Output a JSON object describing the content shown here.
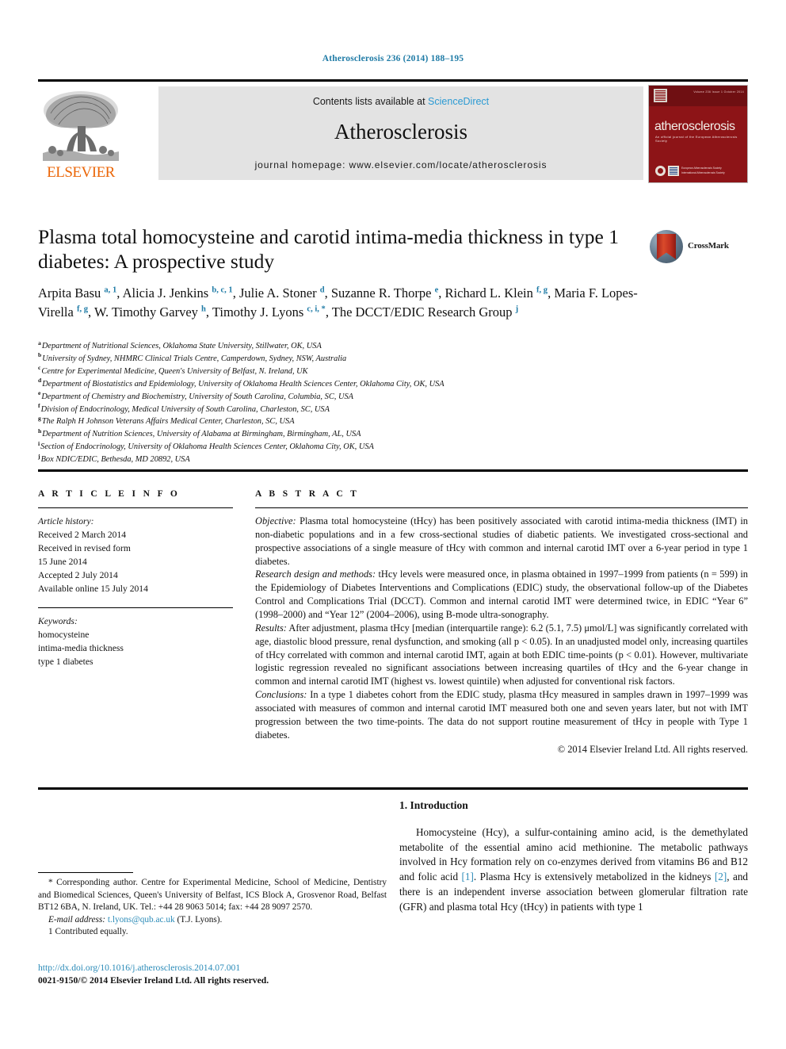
{
  "running_head": "Atherosclerosis 236 (2014) 188–195",
  "masthead": {
    "publisher_name": "ELSEVIER",
    "contents_prefix": "Contents lists available at ",
    "contents_link": "ScienceDirect",
    "journal_title": "Atherosclerosis",
    "homepage_line": "journal homepage: www.elsevier.com/locate/atherosclerosis",
    "cover": {
      "journal_name": "atherosclerosis",
      "subtitle": "An official journal of the European Atherosclerosis Society",
      "topright": "Volume 236  Issue 1  October 2014",
      "badge_text": "European Atherosclerosis Society  International Atherosclerosis Society"
    }
  },
  "article": {
    "title": "Plasma total homocysteine and carotid intima-media thickness in type 1 diabetes: A prospective study",
    "crossmark_label": "CrossMark",
    "authors": [
      {
        "name": "Arpita Basu",
        "sup": "a, 1",
        "sep": ", "
      },
      {
        "name": "Alicia J. Jenkins",
        "sup": "b, c, 1",
        "sep": ", "
      },
      {
        "name": "Julie A. Stoner",
        "sup": "d",
        "sep": ", "
      },
      {
        "name": "Suzanne R. Thorpe",
        "sup": "e",
        "sep": ", "
      },
      {
        "name": "Richard L. Klein",
        "sup": "f, g",
        "sep": ", "
      },
      {
        "name": "Maria F. Lopes-Virella",
        "sup": "f, g",
        "sep": ", "
      },
      {
        "name": "W. Timothy Garvey",
        "sup": "h",
        "sep": ", "
      },
      {
        "name": "Timothy J. Lyons",
        "sup": "c, i, *",
        "sep": ", "
      },
      {
        "name": "The DCCT/EDIC Research Group",
        "sup": "j",
        "sep": ""
      }
    ],
    "affiliations": [
      {
        "mark": "a",
        "text": "Department of Nutritional Sciences, Oklahoma State University, Stillwater, OK, USA"
      },
      {
        "mark": "b",
        "text": "University of Sydney, NHMRC Clinical Trials Centre, Camperdown, Sydney, NSW, Australia"
      },
      {
        "mark": "c",
        "text": "Centre for Experimental Medicine, Queen's University of Belfast, N. Ireland, UK"
      },
      {
        "mark": "d",
        "text": "Department of Biostatistics and Epidemiology, University of Oklahoma Health Sciences Center, Oklahoma City, OK, USA"
      },
      {
        "mark": "e",
        "text": "Department of Chemistry and Biochemistry, University of South Carolina, Columbia, SC, USA"
      },
      {
        "mark": "f",
        "text": "Division of Endocrinology, Medical University of South Carolina, Charleston, SC, USA"
      },
      {
        "mark": "g",
        "text": "The Ralph H Johnson Veterans Affairs Medical Center, Charleston, SC, USA"
      },
      {
        "mark": "h",
        "text": "Department of Nutrition Sciences, University of Alabama at Birmingham, Birmingham, AL, USA"
      },
      {
        "mark": "i",
        "text": "Section of Endocrinology, University of Oklahoma Health Sciences Center, Oklahoma City, OK, USA"
      },
      {
        "mark": "j",
        "text": "Box NDIC/EDIC, Bethesda, MD 20892, USA"
      }
    ]
  },
  "article_info": {
    "heading": "A R T I C L E   I N F O",
    "history_label": "Article history:",
    "history_lines": [
      "Received 2 March 2014",
      "Received in revised form",
      "15 June 2014",
      "Accepted 2 July 2014",
      "Available online 15 July 2014"
    ],
    "keywords_label": "Keywords:",
    "keywords": [
      "homocysteine",
      "intima-media thickness",
      "type 1 diabetes"
    ]
  },
  "abstract": {
    "heading": "A B S T R A C T",
    "objective_label": "Objective:",
    "objective_text": " Plasma total homocysteine (tHcy) has been positively associated with carotid intima-media thickness (IMT) in non-diabetic populations and in a few cross-sectional studies of diabetic patients. We investigated cross-sectional and prospective associations of a single measure of tHcy with common and internal carotid IMT over a 6-year period in type 1 diabetes.",
    "methods_label": "Research design and methods:",
    "methods_text": " tHcy levels were measured once, in plasma obtained in 1997–1999 from patients (n = 599) in the Epidemiology of Diabetes Interventions and Complications (EDIC) study, the observational follow-up of the Diabetes Control and Complications Trial (DCCT). Common and internal carotid IMT were determined twice, in EDIC “Year 6” (1998–2000) and “Year 12” (2004–2006), using B-mode ultra-sonography.",
    "results_label": "Results:",
    "results_text": " After adjustment, plasma tHcy [median (interquartile range): 6.2 (5.1, 7.5) μmol/L] was significantly correlated with age, diastolic blood pressure, renal dysfunction, and smoking (all p < 0.05). In an unadjusted model only, increasing quartiles of tHcy correlated with common and internal carotid IMT, again at both EDIC time-points (p < 0.01). However, multivariate logistic regression revealed no significant associations between increasing quartiles of tHcy and the 6-year change in common and internal carotid IMT (highest vs. lowest quintile) when adjusted for conventional risk factors.",
    "conclusions_label": "Conclusions:",
    "conclusions_text": " In a type 1 diabetes cohort from the EDIC study, plasma tHcy measured in samples drawn in 1997–1999 was associated with measures of common and internal carotid IMT measured both one and seven years later, but not with IMT progression between the two time-points. The data do not support routine measurement of tHcy in people with Type 1 diabetes.",
    "copyright": "© 2014 Elsevier Ireland Ltd. All rights reserved."
  },
  "introduction": {
    "heading": "1. Introduction",
    "paragraph_1a": "Homocysteine (Hcy), a sulfur-containing amino acid, is the demethylated metabolite of the essential amino acid methionine. The metabolic pathways involved in Hcy formation rely on co-enzymes derived from vitamins B6 and B12 and folic acid ",
    "cite_1": "[1]",
    "paragraph_1b": ". Plasma Hcy is extensively metabolized in the kidneys ",
    "cite_2": "[2]",
    "paragraph_1c": ", and there is an independent inverse association between glomerular filtration rate (GFR) and plasma total Hcy (tHcy) in patients with type 1"
  },
  "footnotes": {
    "corresponding": "* Corresponding author. Centre for Experimental Medicine, School of Medicine, Dentistry and Biomedical Sciences, Queen's University of Belfast, ICS Block A, Grosvenor Road, Belfast BT12 6BA, N. Ireland, UK. Tel.: +44 28 9063 5014; fax: +44 28 9097 2570.",
    "email_label": "E-mail address:",
    "email": "t.lyons@qub.ac.uk",
    "email_suffix": " (T.J. Lyons).",
    "contributed": "1 Contributed equally.",
    "doi_url": "http://dx.doi.org/10.1016/j.atherosclerosis.2014.07.001",
    "issn_line": "0021-9150/© 2014 Elsevier Ireland Ltd. All rights reserved."
  }
}
